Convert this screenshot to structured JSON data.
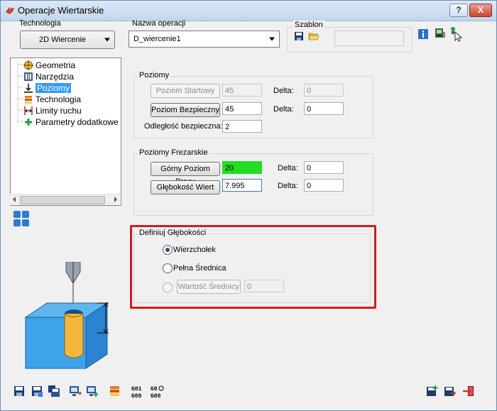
{
  "window": {
    "title": "Operacje Wiertarskie",
    "help_label": "?",
    "close_label": "X"
  },
  "header": {
    "technologia_label": "Technologia",
    "technologia_value": "2D Wiercenie",
    "nazwa_label": "Nazwa operacji",
    "nazwa_value": "D_wiercenie1",
    "szablon_label": "Szablon",
    "szablon_value": ""
  },
  "tree": {
    "items": [
      {
        "label": "Geometria",
        "icon": "target-icon"
      },
      {
        "label": "Narzędzia",
        "icon": "tools-icon"
      },
      {
        "label": "Poziomy",
        "icon": "levels-icon",
        "selected": true
      },
      {
        "label": "Technologia",
        "icon": "technology-icon"
      },
      {
        "label": "Limity ruchu",
        "icon": "limits-icon"
      },
      {
        "label": "Parametry dodatkowe",
        "icon": "plus-icon"
      }
    ]
  },
  "poziomy": {
    "title": "Poziomy",
    "startowy_label": "Poziom Startowy",
    "startowy_value": "45",
    "startowy_delta_label": "Delta:",
    "startowy_delta_value": "0",
    "bezpieczny_label": "Poziom Bezpieczny",
    "bezpieczny_value": "45",
    "bezpieczny_delta_label": "Delta:",
    "bezpieczny_delta_value": "0",
    "odleglosc_label": "Odległość bezpieczna:",
    "odleglosc_value": "2"
  },
  "frezarskie": {
    "title": "Poziomy Frezarskie",
    "gorny_label": "Górny Poziom Pracy",
    "gorny_value": "20",
    "gorny_delta_label": "Delta:",
    "gorny_delta_value": "0",
    "glebokosc_label": "Głębokość Wiert",
    "glebokosc_value": "7.995",
    "glebokosc_delta_label": "Delta:",
    "glebokosc_delta_value": "0"
  },
  "definiuj": {
    "title": "Definiuj Głębokości",
    "option1": "Wierzchołek",
    "option2": "Pełna Średnica",
    "option3": "Wartość Średnicy",
    "option3_value": "0",
    "selected": "Wierzchołek"
  },
  "toolbar": {
    "g01_label": "G01\nG00",
    "g0_label": "G0\nG00"
  },
  "colors": {
    "accent": "#3399ff",
    "highlight_field": "#22dd22",
    "frame": "#cc1f1f"
  }
}
